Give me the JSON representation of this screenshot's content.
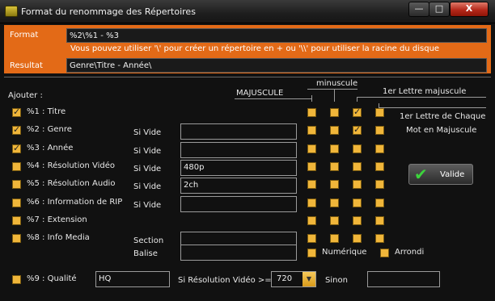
{
  "window": {
    "title": "Format du renommage des Répertoires",
    "min": "—",
    "max": "□",
    "close": "X"
  },
  "header": {
    "format_label": "Format",
    "format_value": "%2\\%1 - %3",
    "hint": "Vous pouvez utiliser '\\' pour créer un répertoire en + ou '\\\\' pour utiliser la racine du disque",
    "result_label": "Resultat",
    "result_value": "Genre\\Titre - Année\\"
  },
  "columns": {
    "ajouter": "Ajouter :",
    "majuscule": "MAJUSCULE",
    "minuscule": "minuscule",
    "first_letter": "1er Lettre majuscule",
    "each_word_line1": "1er Lettre de Chaque",
    "each_word_line2": "Mot en Majuscule"
  },
  "rows": [
    {
      "label": "%1 : Titre",
      "checked": true,
      "cond": "",
      "value": "",
      "case": [
        false,
        false,
        true,
        false
      ]
    },
    {
      "label": "%2 : Genre",
      "checked": true,
      "cond": "Si Vide",
      "value": "",
      "case": [
        false,
        false,
        true,
        false
      ]
    },
    {
      "label": "%3 : Année",
      "checked": true,
      "cond": "Si Vide",
      "value": "",
      "case": [
        false,
        false,
        false,
        false
      ]
    },
    {
      "label": "%4 : Résolution Vidéo",
      "checked": false,
      "cond": "Si Vide",
      "value": "480p",
      "case": [
        false,
        false,
        false,
        false
      ]
    },
    {
      "label": "%5 : Résolution Audio",
      "checked": false,
      "cond": "Si Vide",
      "value": "2ch",
      "case": [
        false,
        false,
        false,
        false
      ]
    },
    {
      "label": "%6 : Information de RIP",
      "checked": false,
      "cond": "Si Vide",
      "value": "",
      "case": [
        false,
        false,
        false,
        false
      ]
    },
    {
      "label": "%7 : Extension",
      "checked": false,
      "cond": "",
      "value": "",
      "case": [
        false,
        false,
        false,
        false
      ]
    },
    {
      "label": "%8 : Info Media",
      "checked": false,
      "cond": "Section",
      "value": "",
      "case": [
        false,
        false,
        false,
        false
      ]
    }
  ],
  "balise": {
    "label": "Balise",
    "value": ""
  },
  "numerique_label": "Numérique",
  "arrondi_label": "Arrondi",
  "valide_label": "Valide",
  "qualite": {
    "label": "%9 : Qualité",
    "value": "HQ",
    "res_label": "Si Résolution Vidéo >=",
    "res_value": "720",
    "sinon_label": "Sinon",
    "sinon_value": ""
  }
}
